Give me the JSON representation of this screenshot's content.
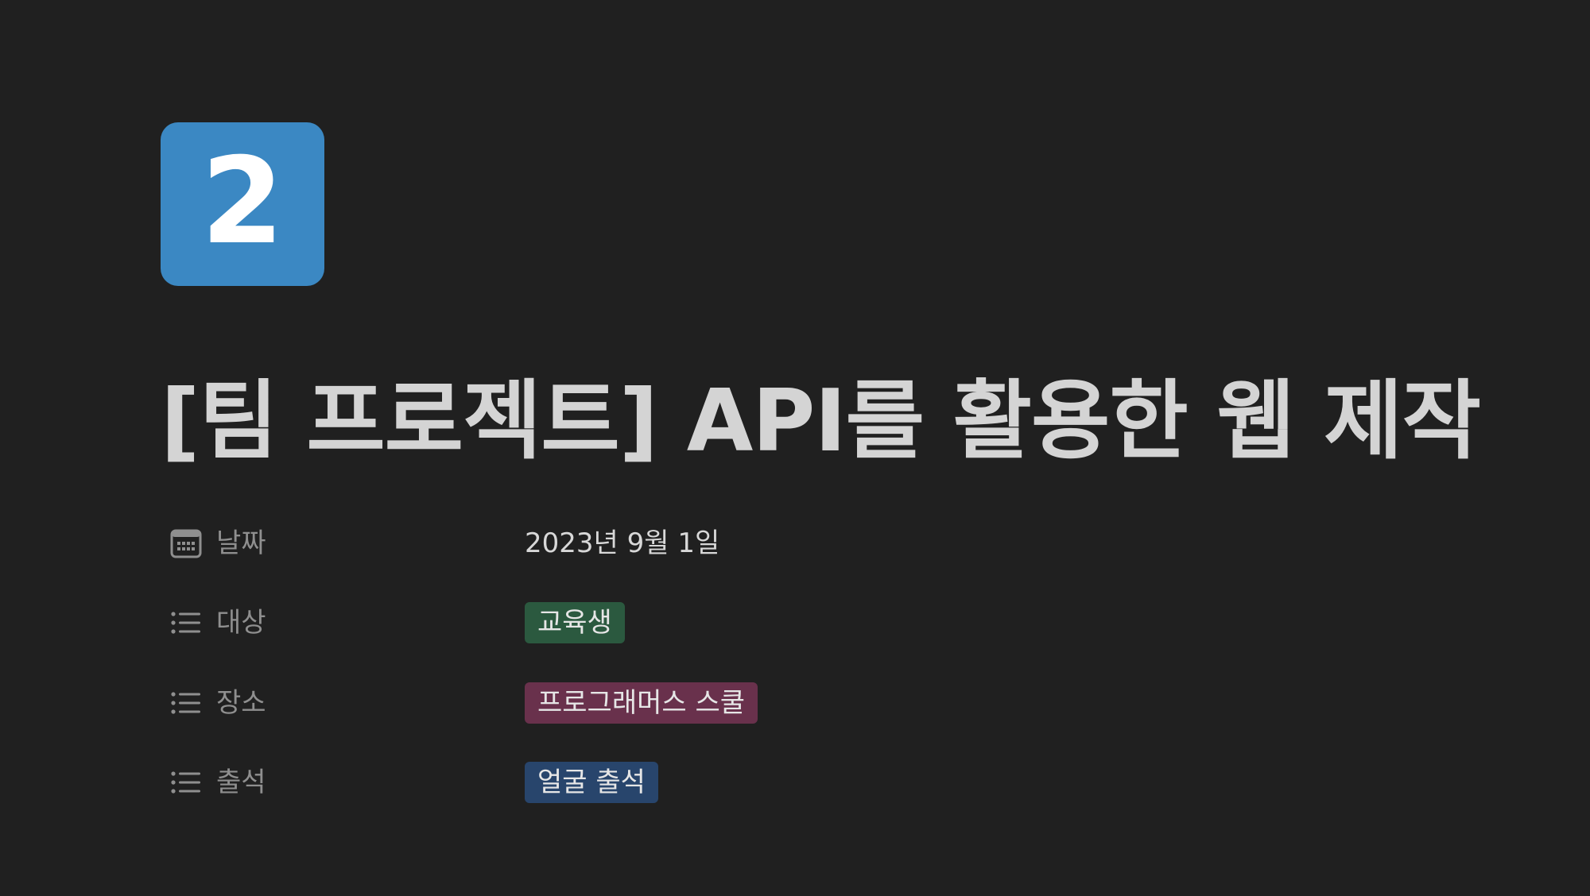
{
  "page": {
    "icon_text": "2",
    "icon_color": "#3b88c3",
    "title": "[팀 프로젝트] API를 활용한 웹 제작"
  },
  "properties": [
    {
      "name": "날짜",
      "icon": "calendar-icon",
      "type": "date",
      "value": "2023년 9월 1일"
    },
    {
      "name": "대상",
      "icon": "list-icon",
      "type": "select",
      "value": "교육생",
      "tag_color": "#2b593f"
    },
    {
      "name": "장소",
      "icon": "list-icon",
      "type": "select",
      "value": "프로그래머스 스쿨",
      "tag_color": "#69314c"
    },
    {
      "name": "출석",
      "icon": "list-icon",
      "type": "select",
      "value": "얼굴 출석",
      "tag_color": "#28456c"
    }
  ]
}
